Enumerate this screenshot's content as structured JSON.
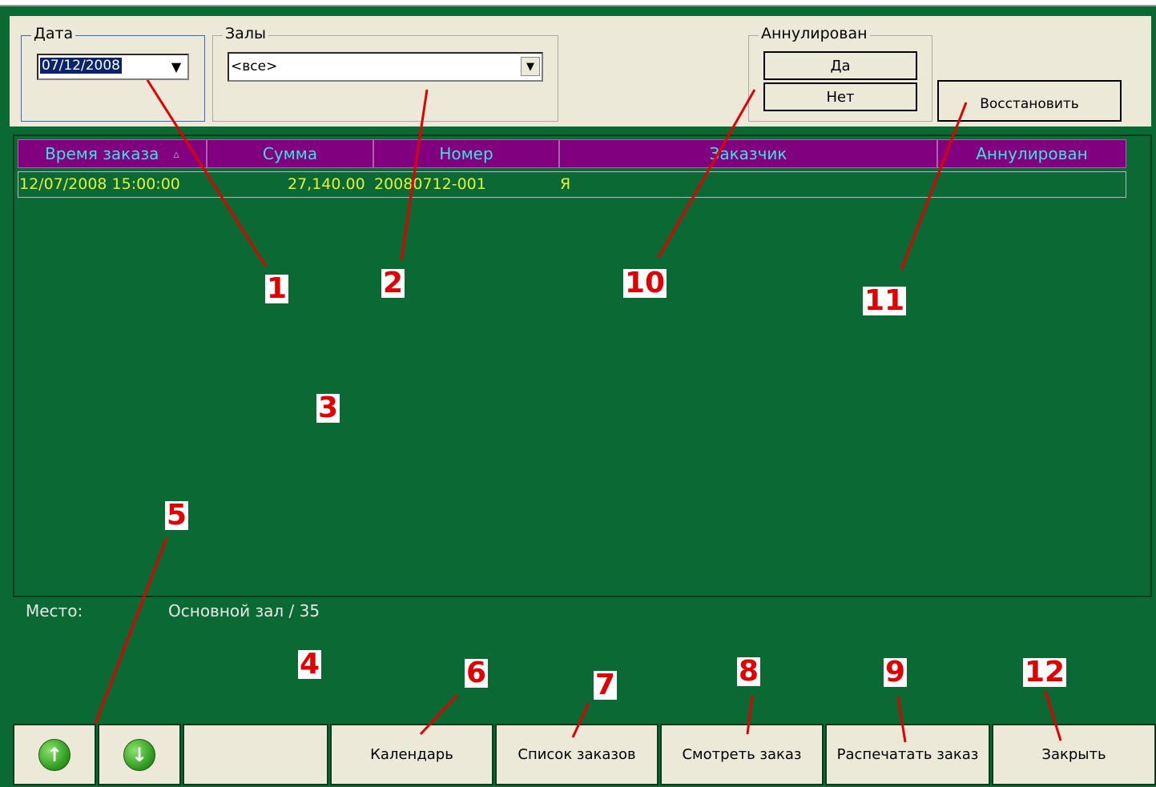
{
  "filters": {
    "date": {
      "legend": "Дата",
      "value": "07/12/2008"
    },
    "halls": {
      "legend": "Залы",
      "value": "<все>"
    },
    "cancelled": {
      "legend": "Аннулирован",
      "yes": "Да",
      "no": "Нет"
    },
    "restore_label": "Восстановить"
  },
  "table": {
    "columns": [
      "Время заказа",
      "Сумма",
      "Номер",
      "Заказчик",
      "Аннулирован"
    ],
    "sort_indicator": "▵",
    "rows": [
      {
        "time": "12/07/2008 15:00:00",
        "sum": "27,140.00",
        "number": "20080712-001",
        "customer": "Я",
        "cancelled": ""
      }
    ]
  },
  "place": {
    "label": "Место:",
    "value": "Основной зал / 35"
  },
  "toolbar": {
    "up_icon": "arrow-up-icon",
    "down_icon": "arrow-down-icon",
    "calendar": "Календарь",
    "orders_list": "Список заказов",
    "view_order": "Смотреть заказ",
    "print_order": "Распечатать заказ",
    "close": "Закрыть"
  },
  "annotations": [
    "1",
    "2",
    "3",
    "4",
    "5",
    "6",
    "7",
    "8",
    "9",
    "10",
    "11",
    "12"
  ],
  "colors": {
    "background": "#0b6a33",
    "header": "#800080",
    "header_text": "#3fe0e0",
    "row_text": "#e3f23c",
    "annotation": "#e00000"
  }
}
